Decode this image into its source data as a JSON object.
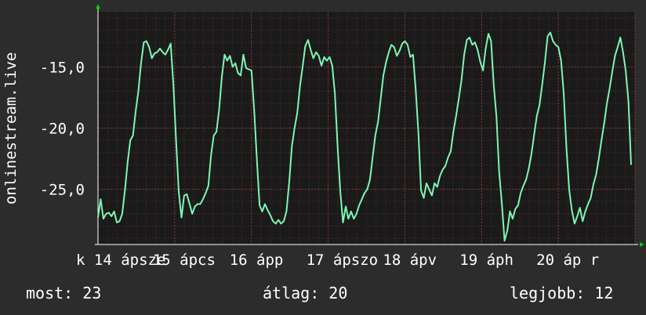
{
  "chart_data": {
    "type": "line",
    "ylabel": "onlinestream.live",
    "y_ticks": [
      "-15,0",
      "-20,0",
      "-25,0"
    ],
    "y_tick_values": [
      -15,
      -20,
      -25
    ],
    "ylim": [
      -29.5,
      -10.5
    ],
    "x_tick_labels": [
      "k 14 ápsze",
      "15 ápcs",
      "16 ápp",
      "17 ápszo",
      "18 ápv",
      "19 áph",
      "20 áp r"
    ],
    "grid": true,
    "colors": {
      "background": "#2c2c2c",
      "plot": "#1a1a1a",
      "grid": "#5a2b2b",
      "line": "#7cf7b4",
      "axis": "#ffffff",
      "arrow": "#00cc00"
    },
    "series": [
      {
        "values": [
          -27.3,
          -25.8,
          -27.4,
          -27.0,
          -26.9,
          -27.2,
          -26.8,
          -27.7,
          -27.6,
          -27.0,
          -25.1,
          -22.8,
          -21.0,
          -20.6,
          -18.6,
          -17.0,
          -14.7,
          -13.0,
          -12.9,
          -13.4,
          -14.3,
          -13.9,
          -13.8,
          -13.5,
          -13.8,
          -14.0,
          -13.6,
          -13.1,
          -16.5,
          -21.0,
          -25.2,
          -27.3,
          -25.5,
          -25.4,
          -26.2,
          -27.0,
          -26.4,
          -26.2,
          -26.2,
          -25.8,
          -25.3,
          -24.7,
          -22.2,
          -20.6,
          -20.3,
          -18.5,
          -15.8,
          -14.0,
          -14.5,
          -14.1,
          -15.0,
          -14.7,
          -15.5,
          -15.7,
          -14.0,
          -15.1,
          -15.2,
          -15.3,
          -18.5,
          -22.5,
          -26.3,
          -26.8,
          -26.2,
          -26.7,
          -27.1,
          -27.6,
          -27.8,
          -27.5,
          -27.8,
          -27.6,
          -26.8,
          -24.5,
          -21.5,
          -20.0,
          -18.8,
          -16.6,
          -15.0,
          -13.3,
          -12.8,
          -13.6,
          -14.3,
          -13.8,
          -14.1,
          -14.9,
          -14.2,
          -14.5,
          -14.2,
          -14.9,
          -17.2,
          -21.6,
          -25.2,
          -27.7,
          -26.4,
          -27.4,
          -26.8,
          -27.4,
          -27.0,
          -26.3,
          -25.8,
          -25.3,
          -25.0,
          -24.2,
          -22.4,
          -20.6,
          -19.5,
          -17.6,
          -15.7,
          -14.6,
          -13.8,
          -13.2,
          -13.4,
          -14.1,
          -13.7,
          -13.1,
          -12.9,
          -13.2,
          -14.2,
          -14.0,
          -16.9,
          -20.4,
          -25.1,
          -25.7,
          -24.5,
          -25.0,
          -25.5,
          -24.5,
          -24.8,
          -23.9,
          -23.4,
          -23.1,
          -22.4,
          -21.9,
          -20.3,
          -19.0,
          -17.6,
          -16.1,
          -14.0,
          -12.8,
          -12.6,
          -13.2,
          -13.0,
          -13.6,
          -14.6,
          -15.3,
          -13.5,
          -12.3,
          -12.9,
          -16.5,
          -19.1,
          -23.6,
          -26.2,
          -29.2,
          -28.4,
          -26.8,
          -27.4,
          -26.6,
          -26.3,
          -25.3,
          -24.7,
          -24.2,
          -23.3,
          -22.1,
          -20.5,
          -19.0,
          -18.1,
          -16.4,
          -14.6,
          -12.5,
          -12.2,
          -12.9,
          -13.2,
          -13.4,
          -14.5,
          -17.2,
          -21.7,
          -25.0,
          -26.7,
          -27.8,
          -27.2,
          -26.5,
          -27.6,
          -26.8,
          -26.2,
          -25.7,
          -24.6,
          -23.8,
          -22.5,
          -21.0,
          -19.6,
          -18.0,
          -16.8,
          -15.4,
          -14.1,
          -13.4,
          -12.6,
          -13.8,
          -15.3,
          -17.8,
          -23.0
        ]
      }
    ]
  },
  "stats": {
    "now": "most: 23",
    "avg": "átlag: 20",
    "max": "legjobb: 12"
  }
}
